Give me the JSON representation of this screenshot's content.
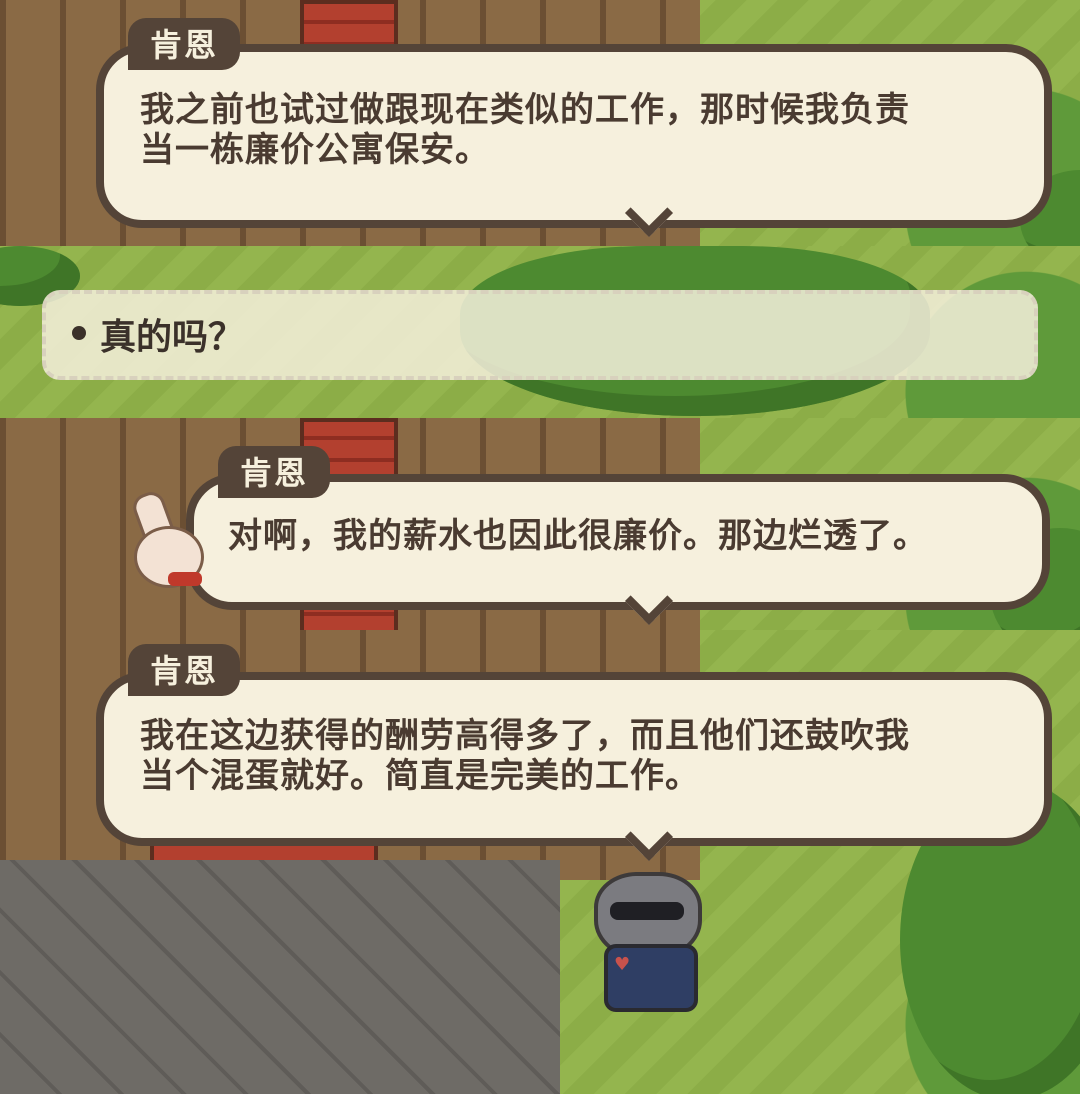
{
  "dialogs": [
    {
      "speaker": "肯恩",
      "lines": [
        "我之前也试过做跟现在类似的工作，那时候我负责",
        "当一栋廉价公寓保安。"
      ]
    },
    {
      "choice": {
        "label": "真的吗？"
      }
    },
    {
      "speaker": "肯恩",
      "lines": [
        "对啊，我的薪水也因此很廉价。那边烂透了。"
      ]
    },
    {
      "speaker": "肯恩",
      "lines": [
        "我在这边获得的酬劳高得多了，而且他们还鼓吹我",
        "当个混蛋就好。简直是完美的工作。"
      ]
    }
  ]
}
